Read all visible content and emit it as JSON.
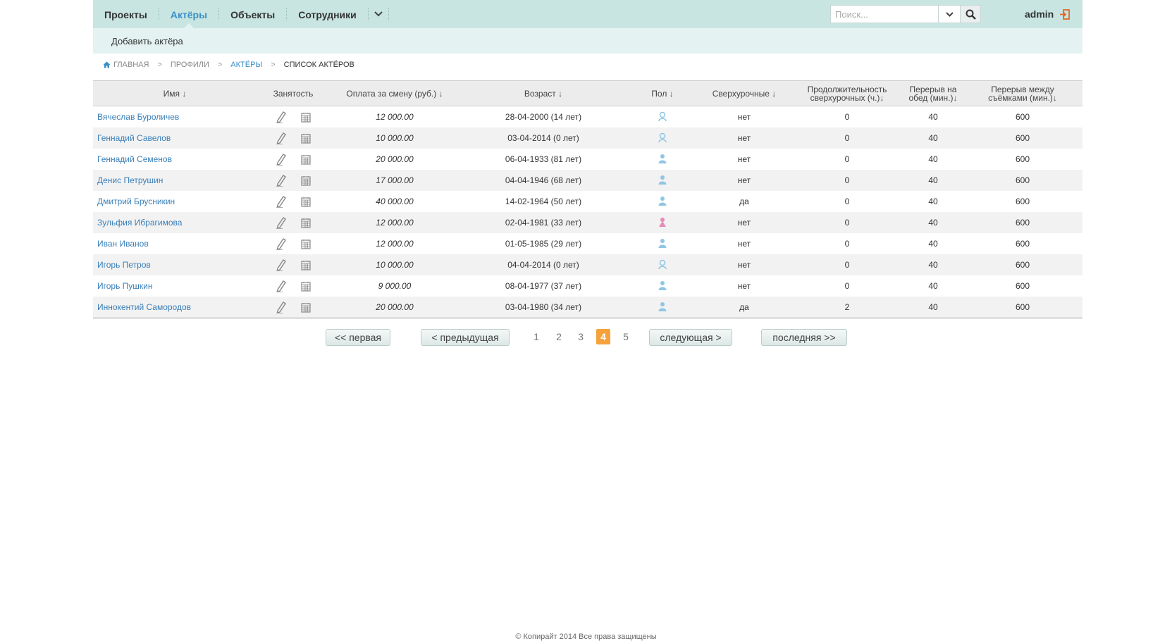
{
  "nav": {
    "items": [
      {
        "label": "Проекты",
        "active": false
      },
      {
        "label": "Актёры",
        "active": true
      },
      {
        "label": "Объекты",
        "active": false
      },
      {
        "label": "Сотрудники",
        "active": false
      }
    ],
    "search_placeholder": "Поиск...",
    "user": "admin"
  },
  "subnav": {
    "add_actor": "Добавить актёра"
  },
  "breadcrumb": {
    "home": "Главная",
    "profiles": "Профили",
    "actors": "Актёры",
    "current": "Список актёров",
    "separator": ">"
  },
  "table": {
    "headers": {
      "name": "Имя",
      "busy": "Занятость",
      "pay": "Оплата за смену (руб.)",
      "age": "Возраст",
      "sex": "Пол",
      "overtime": "Сверхурочные",
      "overtime_len_1": "Продолжительность",
      "overtime_len_2": "сверхурочных (ч.)",
      "lunch_1": "Перерыв на",
      "lunch_2": "обед (мин.)",
      "break_1": "Перерыв между",
      "break_2": "съёмками (мин.)",
      "sort_arrow": "↓"
    },
    "rows": [
      {
        "name": "Вячеслав Буроличев",
        "pay": "12 000.00",
        "age": "28-04-2000 (14 лет)",
        "sex": "unknown",
        "overtime": "нет",
        "ot_len": "0",
        "lunch": "40",
        "brk": "600"
      },
      {
        "name": "Геннадий Савелов",
        "pay": "10 000.00",
        "age": "03-04-2014 (0 лет)",
        "sex": "unknown",
        "overtime": "нет",
        "ot_len": "0",
        "lunch": "40",
        "brk": "600"
      },
      {
        "name": "Геннадий Семенов",
        "pay": "20 000.00",
        "age": "06-04-1933 (81 лет)",
        "sex": "male",
        "overtime": "нет",
        "ot_len": "0",
        "lunch": "40",
        "brk": "600"
      },
      {
        "name": "Денис Петрушин",
        "pay": "17 000.00",
        "age": "04-04-1946 (68 лет)",
        "sex": "male",
        "overtime": "нет",
        "ot_len": "0",
        "lunch": "40",
        "brk": "600"
      },
      {
        "name": "Дмитрий Брусникин",
        "pay": "40 000.00",
        "age": "14-02-1964 (50 лет)",
        "sex": "male",
        "overtime": "да",
        "ot_len": "0",
        "lunch": "40",
        "brk": "600"
      },
      {
        "name": "Зульфия Ибрагимова",
        "pay": "12 000.00",
        "age": "02-04-1981 (33 лет)",
        "sex": "female",
        "overtime": "нет",
        "ot_len": "0",
        "lunch": "40",
        "brk": "600"
      },
      {
        "name": "Иван Иванов",
        "pay": "12 000.00",
        "age": "01-05-1985 (29 лет)",
        "sex": "male",
        "overtime": "нет",
        "ot_len": "0",
        "lunch": "40",
        "brk": "600"
      },
      {
        "name": "Игорь Петров",
        "pay": "10 000.00",
        "age": "04-04-2014 (0 лет)",
        "sex": "unknown",
        "overtime": "нет",
        "ot_len": "0",
        "lunch": "40",
        "brk": "600"
      },
      {
        "name": "Игорь Пушкин",
        "pay": "9 000.00",
        "age": "08-04-1977 (37 лет)",
        "sex": "male",
        "overtime": "нет",
        "ot_len": "0",
        "lunch": "40",
        "brk": "600"
      },
      {
        "name": "Иннокентий Самородов",
        "pay": "20 000.00",
        "age": "03-04-1980 (34 лет)",
        "sex": "male",
        "overtime": "да",
        "ot_len": "2",
        "lunch": "40",
        "brk": "600"
      }
    ]
  },
  "pager": {
    "first": "<<  первая",
    "prev": "<  предыдущая",
    "pages": [
      "1",
      "2",
      "3",
      "4",
      "5"
    ],
    "current": "4",
    "next": "следующая  >",
    "last": "последняя  >>"
  },
  "footer": "© Копирайт 2014 Все права защищены",
  "colors": {
    "topbar": "#c8e5e1",
    "subbar": "#e4f3f1",
    "accent": "#3a8fc8",
    "current_page": "#f6a23a",
    "female": "#e58bb5",
    "male": "#8fc6e3"
  }
}
